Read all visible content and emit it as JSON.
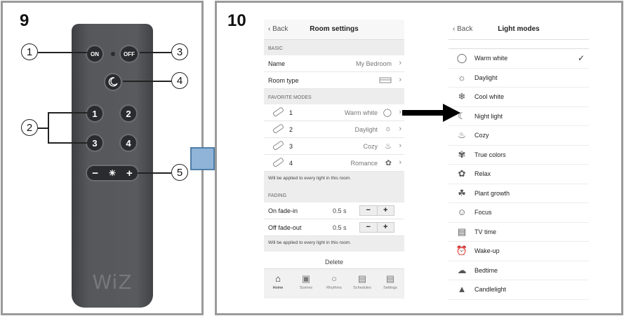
{
  "figure9": {
    "number": "9",
    "remote": {
      "on_label": "ON",
      "off_label": "OFF",
      "night_icon": "moon-icon",
      "scene_buttons": [
        "1",
        "2",
        "3",
        "4"
      ],
      "minus_label": "−",
      "sun_label": "☀",
      "plus_label": "+",
      "logo": "WiZ"
    },
    "callouts": [
      "1",
      "2",
      "3",
      "4",
      "5"
    ]
  },
  "figure10": {
    "number": "10",
    "room_settings": {
      "back_label": "Back",
      "title": "Room settings",
      "basic_label": "BASIC",
      "name_label": "Name",
      "name_value": "My Bedroom",
      "room_type_label": "Room type",
      "favorite_modes_label": "FAVORITE MODES",
      "favorite_modes": [
        {
          "num": "1",
          "mode": "Warm white",
          "icon": "bulb-icon"
        },
        {
          "num": "2",
          "mode": "Daylight",
          "icon": "sun-icon"
        },
        {
          "num": "3",
          "mode": "Cozy",
          "icon": "cozy-icon"
        },
        {
          "num": "4",
          "mode": "Romance",
          "icon": "romance-icon"
        }
      ],
      "favorite_note": "Will be applied to every light in this room.",
      "fading_label": "FADING",
      "fade_in_label": "On fade-in",
      "fade_in_value": "0.5 s",
      "fade_out_label": "Off fade-out",
      "fade_out_value": "0.5 s",
      "fading_note": "Will be applied to every light in this room.",
      "delete_label": "Delete",
      "tabs": [
        {
          "label": "Home",
          "icon": "home-icon"
        },
        {
          "label": "Scenes",
          "icon": "scenes-icon"
        },
        {
          "label": "Rhythms",
          "icon": "rhythms-icon"
        },
        {
          "label": "Schedules",
          "icon": "schedules-icon"
        },
        {
          "label": "Settings",
          "icon": "settings-icon"
        }
      ]
    },
    "light_modes": {
      "back_label": "Back",
      "title": "Light modes",
      "modes": [
        {
          "label": "Warm white",
          "icon": "bulb-icon",
          "selected": true
        },
        {
          "label": "Daylight",
          "icon": "sun-icon"
        },
        {
          "label": "Cool white",
          "icon": "snowflake-icon"
        },
        {
          "label": "Night light",
          "icon": "moon-icon"
        },
        {
          "label": "Cozy",
          "icon": "cozy-icon"
        },
        {
          "label": "True colors",
          "icon": "palette-icon"
        },
        {
          "label": "Relax",
          "icon": "lotus-icon"
        },
        {
          "label": "Plant growth",
          "icon": "plant-icon"
        },
        {
          "label": "Focus",
          "icon": "focus-icon"
        },
        {
          "label": "TV time",
          "icon": "tv-icon"
        },
        {
          "label": "Wake-up",
          "icon": "alarm-icon"
        },
        {
          "label": "Bedtime",
          "icon": "bedtime-icon"
        },
        {
          "label": "Candlelight",
          "icon": "candle-icon"
        }
      ]
    }
  }
}
